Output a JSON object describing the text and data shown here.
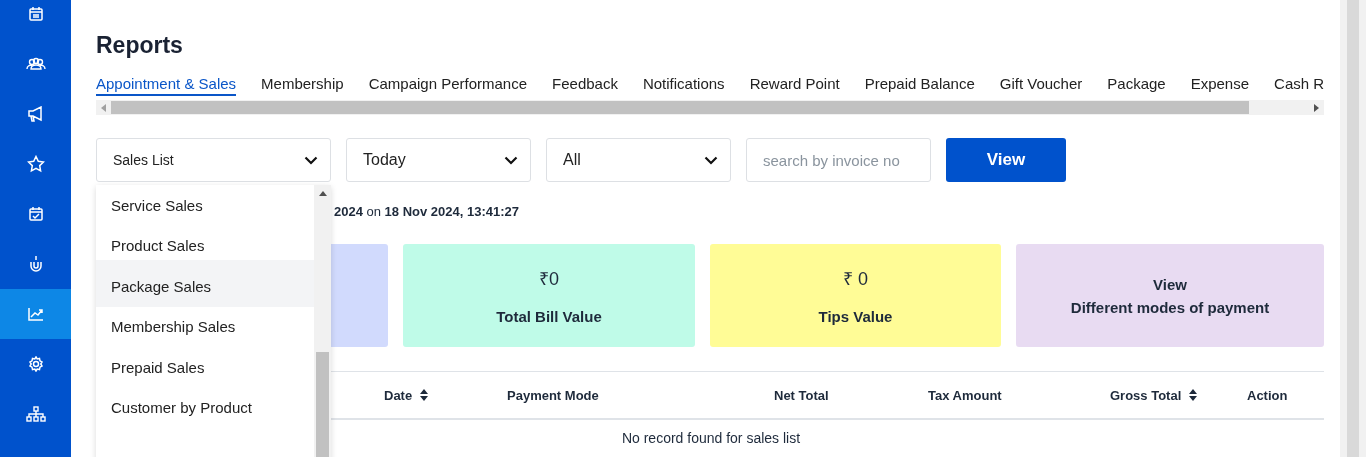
{
  "sidebar": {
    "items": [
      {
        "selected": false
      },
      {
        "selected": false
      },
      {
        "selected": false
      },
      {
        "selected": false
      },
      {
        "selected": false
      },
      {
        "selected": false
      },
      {
        "selected": true
      },
      {
        "selected": false
      },
      {
        "selected": false
      }
    ]
  },
  "title": "Reports",
  "tabs": [
    {
      "label": "Appointment & Sales",
      "selected": true
    },
    {
      "label": "Membership",
      "selected": false
    },
    {
      "label": "Campaign Performance",
      "selected": false
    },
    {
      "label": "Feedback",
      "selected": false
    },
    {
      "label": "Notifications",
      "selected": false
    },
    {
      "label": "Reward Point",
      "selected": false
    },
    {
      "label": "Prepaid Balance",
      "selected": false
    },
    {
      "label": "Gift Voucher",
      "selected": false
    },
    {
      "label": "Package",
      "selected": false
    },
    {
      "label": "Expense",
      "selected": false
    },
    {
      "label": "Cash R",
      "selected": false
    }
  ],
  "filters": {
    "report_type": "Sales List",
    "period": "Today",
    "mode": "All",
    "search": {
      "placeholder": "search by invoice no"
    },
    "button": "View"
  },
  "report_type_options": [
    {
      "label": "Service Sales",
      "selected": false
    },
    {
      "label": "Product Sales",
      "selected": false
    },
    {
      "label": "Package Sales",
      "selected": true
    },
    {
      "label": "Membership Sales",
      "selected": false
    },
    {
      "label": "Prepaid Sales",
      "selected": false
    },
    {
      "label": "Customer by Product",
      "selected": false
    }
  ],
  "generated_text": "**2024** on **18 Nov 2024, 13:41:27**",
  "cards": [
    {
      "color": "#d1dafd"
    },
    {
      "value": "₹0",
      "label": "Total Bill Value",
      "color": "#bffbe8"
    },
    {
      "value": "₹ 0",
      "label": "Tips Value",
      "color": "#fffc96"
    },
    {
      "value": "View",
      "label": "Different modes of payment",
      "color": "#e8dbf2"
    }
  ],
  "table": {
    "columns": [
      {
        "label": "Date",
        "sortable": true
      },
      {
        "label": "Payment Mode",
        "sortable": false
      },
      {
        "label": "Net Total",
        "sortable": false
      },
      {
        "label": "Tax Amount",
        "sortable": false
      },
      {
        "label": "Gross Total",
        "sortable": true
      },
      {
        "label": "Action",
        "sortable": false
      }
    ],
    "empty_message": "No record found for sales list"
  }
}
